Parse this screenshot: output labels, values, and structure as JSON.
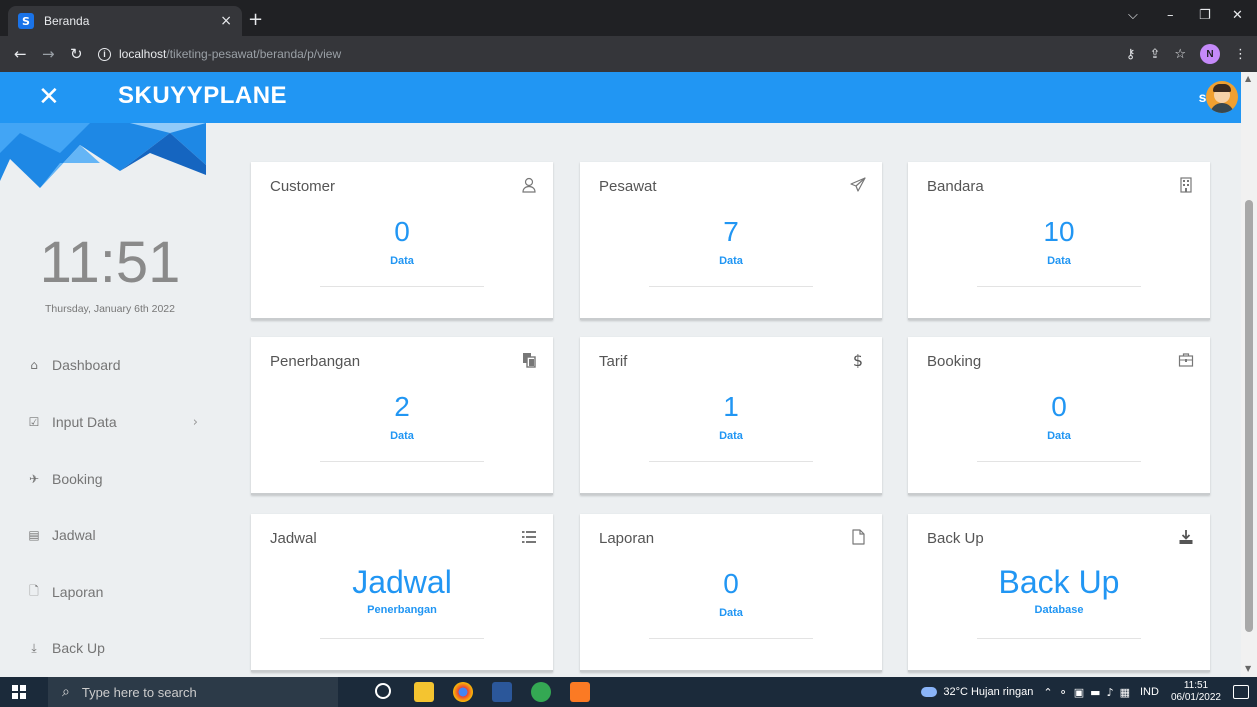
{
  "browser": {
    "tab_title": "Beranda",
    "tab_favicon": "S",
    "url_host": "localhost",
    "url_path": "/tiketing-pesawat/beranda/p/view",
    "profile_initial": "N"
  },
  "header": {
    "brand": "SKUYYPLANE",
    "username": "su"
  },
  "sidebar": {
    "clock_time": "11:51",
    "clock_date": "Thursday, January 6th 2022",
    "items": [
      {
        "label": "Dashboard",
        "icon": "home-icon"
      },
      {
        "label": "Input Data",
        "icon": "checkbox-icon"
      },
      {
        "label": "Booking",
        "icon": "plane-icon"
      },
      {
        "label": "Jadwal",
        "icon": "card-icon"
      },
      {
        "label": "Laporan",
        "icon": "file-icon"
      },
      {
        "label": "Back Up",
        "icon": "download-icon"
      }
    ]
  },
  "cards": [
    {
      "title": "Customer",
      "value": "0",
      "sub": "Data",
      "icon": "user-icon"
    },
    {
      "title": "Pesawat",
      "value": "7",
      "sub": "Data",
      "icon": "plane-icon"
    },
    {
      "title": "Bandara",
      "value": "10",
      "sub": "Data",
      "icon": "building-icon"
    },
    {
      "title": "Penerbangan",
      "value": "2",
      "sub": "Data",
      "icon": "copy-icon"
    },
    {
      "title": "Tarif",
      "value": "1",
      "sub": "Data",
      "icon": "dollar-icon"
    },
    {
      "title": "Booking",
      "value": "0",
      "sub": "Data",
      "icon": "briefcase-icon"
    },
    {
      "title": "Jadwal",
      "value": "Jadwal",
      "sub": "Penerbangan",
      "icon": "list-icon"
    },
    {
      "title": "Laporan",
      "value": "0",
      "sub": "Data",
      "icon": "file-icon"
    },
    {
      "title": "Back Up",
      "value": "Back Up",
      "sub": "Database",
      "icon": "download-icon"
    }
  ],
  "taskbar": {
    "search_placeholder": "Type here to search",
    "weather": "32°C  Hujan ringan",
    "language": "IND",
    "time": "11:51",
    "date": "06/01/2022"
  },
  "colors": {
    "accent": "#2196f3",
    "background": "#eceff1"
  }
}
